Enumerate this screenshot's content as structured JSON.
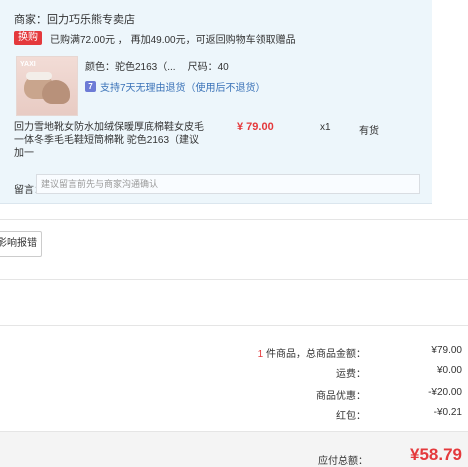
{
  "merchant": {
    "label": "商家：",
    "name": "回力巧乐熊专卖店"
  },
  "promo": {
    "tag": "换购",
    "text": "已购满72.00元 ， 再加49.00元，可返回购物车领取赠品"
  },
  "product": {
    "thumb_logo": "YAXI",
    "color": "颜色：驼色2163（...",
    "size": "尺码：40",
    "return_policy": "支持7天无理由退货（使用后不退货）",
    "title": "回力雪地靴女防水加绒保暖厚底棉鞋女皮毛一体冬季毛毛鞋短筒棉靴 驼色2163（建议加一",
    "price": "¥ 79.00",
    "qty": "x1",
    "stock": "有货"
  },
  "remark": {
    "label": "留言：",
    "placeholder": "建议留言前先与商家沟通确认"
  },
  "report_button": "影响报错",
  "summary": {
    "items_count": "1",
    "items_label": "件商品，总商品金额：",
    "items_amount": "¥79.00",
    "shipping_label": "运费：",
    "shipping_amount": "¥0.00",
    "discount_label": "商品优惠：",
    "discount_amount": "-¥20.00",
    "redpacket_label": "红包：",
    "redpacket_amount": "-¥0.21"
  },
  "total": {
    "label": "应付总额：",
    "amount": "¥58.79"
  }
}
